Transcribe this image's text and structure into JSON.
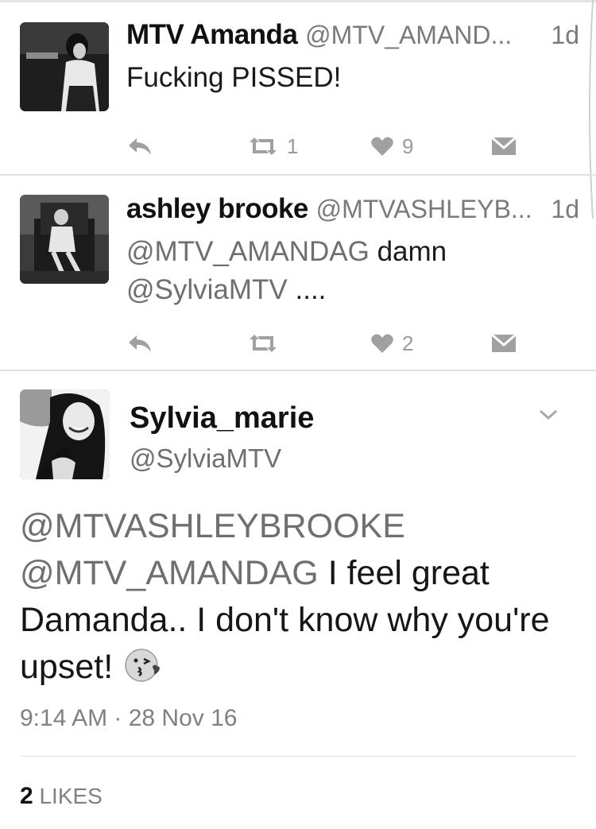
{
  "tweets": [
    {
      "name": "MTV Amanda",
      "handle": "@MTV_AMAND...",
      "time": "1d",
      "text": "Fucking PISSED!",
      "retweets": "1",
      "likes": "9"
    },
    {
      "name": "ashley brooke",
      "handle": "@MTVASHLEYB...",
      "time": "1d",
      "mention1": "@MTV_AMANDAG",
      "text_rest": " damn",
      "mention2": "@SylviaMTV",
      "text_end": " ....",
      "retweets": "",
      "likes": "2"
    }
  ],
  "focused": {
    "name": "Sylvia_marie",
    "handle": "@SylviaMTV",
    "mention1": "@MTVASHLEYBROOKE",
    "mention2": "@MTV_AMANDAG",
    "text_1": " I feel great",
    "text_2": "Damanda.. I don't know why you're",
    "text_3": "upset! ",
    "emoji": "kissing-face-icon",
    "timestamp": "9:14 AM · 28 Nov 16",
    "likes_count": "2",
    "likes_label": "LIKES"
  },
  "colors": {
    "text": "#1a1a1a",
    "secondary": "#7a7a7a",
    "icon": "#a0a0a0",
    "divider": "#e1e1e1"
  }
}
